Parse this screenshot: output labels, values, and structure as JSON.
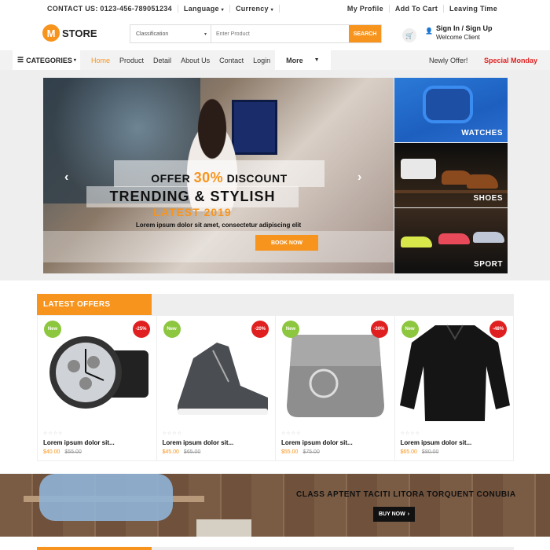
{
  "topbar": {
    "contact": "CONTACT US: 0123-456-789051234",
    "language": "Language",
    "currency": "Currency",
    "my_profile": "My Profile",
    "add_to_cart": "Add To Cart",
    "leaving_time": "Leaving Time"
  },
  "header": {
    "logo_letter": "M",
    "logo_text": "STORE",
    "search_category": "Classification",
    "search_placeholder": "Enter Product",
    "search_button": "SEARCH",
    "signin": "Sign In / Sign Up",
    "welcome": "Welcome Client"
  },
  "nav": {
    "categories": "CATEGORIES",
    "links": [
      "Home",
      "Product",
      "Detail",
      "About Us",
      "Contact",
      "Login"
    ],
    "more": "More",
    "newly": "Newly Offer!",
    "special": "Special Monday"
  },
  "hero": {
    "offer_prefix": "OFFER",
    "offer_pct": "30%",
    "offer_suffix": "DISCOUNT",
    "trending": "TRENDING & STYLISH",
    "latest": "LATEST 2019",
    "lorem": "Lorem ipsum dolor sit amet, consectetur adipiscing elit",
    "book_now": "BOOK NOW"
  },
  "side_banners": [
    "WATCHES",
    "SHOES",
    "SPORT"
  ],
  "offers": {
    "title": "LATEST OFFERS",
    "products": [
      {
        "new": "New",
        "discount": "-25%",
        "name": "Lorem ipsum dolor sit...",
        "price": "$40.00",
        "old_price": "$55.00"
      },
      {
        "new": "New",
        "discount": "-20%",
        "name": "Lorem ipsum dolor sit...",
        "price": "$45.00",
        "old_price": "$65.00"
      },
      {
        "new": "New",
        "discount": "-30%",
        "name": "Lorem ipsum dolor sit...",
        "price": "$55.00",
        "old_price": "$75.00"
      },
      {
        "new": "New",
        "discount": "-48%",
        "name": "Lorem ipsum dolor sit...",
        "price": "$65.00",
        "old_price": "$80.00"
      }
    ]
  },
  "banner": {
    "title": "CLASS APTENT TACITI LITORA TORQUENT CONUBIA",
    "button": "BUY NOW"
  },
  "colors": {
    "accent": "#f7941d",
    "new_badge": "#8dc63f",
    "sale_badge": "#e02020"
  }
}
